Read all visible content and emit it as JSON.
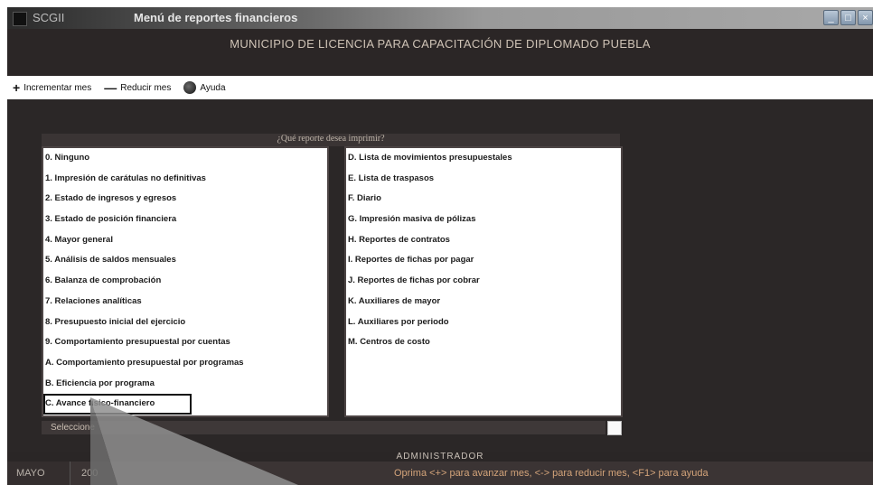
{
  "window": {
    "app_name": "SCGII",
    "title": "Menú de reportes financieros",
    "icons": {
      "minimize": "minimize-icon",
      "maximize": "maximize-icon",
      "close": "close-icon"
    }
  },
  "header": {
    "organization": "MUNICIPIO DE LICENCIA PARA CAPACITACIÓN DE DIPLOMADO PUEBLA"
  },
  "toolbar": {
    "items": [
      {
        "label": "Incrementar mes",
        "icon": "plus-icon"
      },
      {
        "label": "Reducir mes",
        "icon": "minus-icon"
      },
      {
        "label": "Ayuda",
        "icon": "help-globe-icon"
      }
    ]
  },
  "dialog": {
    "question": "¿Qué reporte desea imprimir?",
    "left_options": [
      "0. Ninguno",
      "1. Impresión de carátulas no definitivas",
      "2. Estado de ingresos y egresos",
      "3. Estado de posición financiera",
      "4. Mayor general",
      "5. Análisis de saldos mensuales",
      "6. Balanza de comprobación",
      "7. Relaciones analíticas",
      "8. Presupuesto inicial del ejercicio",
      "9. Comportamiento presupuestal por cuentas",
      "A. Comportamiento presupuestal por programas",
      "B. Eficiencia por programa",
      "C. Avance físico-financiero"
    ],
    "right_options": [
      "D. Lista de movimientos presupuestales",
      "E. Lista de traspasos",
      "F. Diario",
      "G. Impresión masiva de pólizas",
      "H. Reportes de contratos",
      "I. Reportes de fichas por pagar",
      "J. Reportes de fichas por cobrar",
      "K. Auxiliares de mayor",
      "L. Auxiliares por periodo",
      "M. Centros de costo"
    ],
    "selected_label": "Seleccione"
  },
  "footer": {
    "user": "ADMINISTRADOR",
    "month": "MAYO",
    "year": "200",
    "hint": "Oprima <+> para avanzar mes, <-> para reducir mes, <F1> para ayuda"
  }
}
